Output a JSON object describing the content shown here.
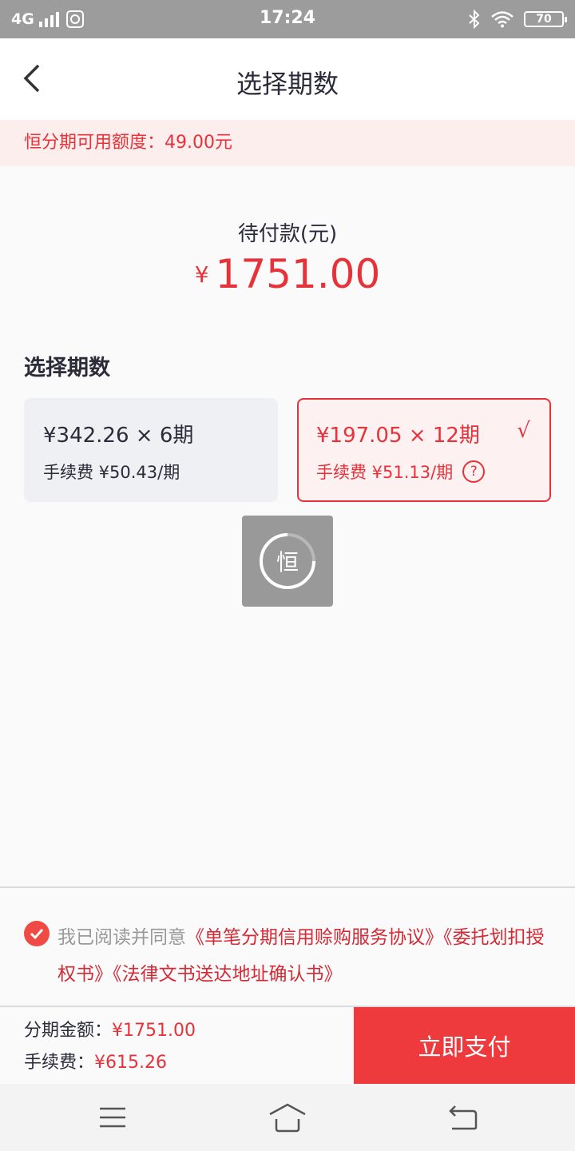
{
  "status_bar": {
    "network": "4G",
    "time": "17:24",
    "battery": "70"
  },
  "header": {
    "title": "选择期数"
  },
  "limit_banner": {
    "text": "恒分期可用额度：49.00元"
  },
  "due": {
    "label": "待付款(元)",
    "currency": "¥",
    "amount": "1751.00"
  },
  "section": {
    "title": "选择期数"
  },
  "plans": [
    {
      "main": "¥342.26 × 6期",
      "fee": "手续费 ¥50.43/期",
      "selected": false
    },
    {
      "main": "¥197.05 × 12期",
      "fee": "手续费 ¥51.13/期",
      "selected": true,
      "check": "√",
      "help": "?"
    }
  ],
  "loader": {
    "char": "恒"
  },
  "agreement": {
    "prefix": "我已阅读并同意",
    "link1": "《单笔分期信用赊购服务协议》",
    "link2": "《委托划扣授权书》",
    "link3": "《法律文书送达地址确认书》",
    "checked": true
  },
  "summary": {
    "amount_label": "分期金额：",
    "amount_value": "¥1751.00",
    "fee_label": "手续费：",
    "fee_value": "¥615.26"
  },
  "pay_button": {
    "label": "立即支付"
  },
  "colors": {
    "accent": "#e8323a",
    "banner_bg": "#fdeeee",
    "pay_button": "#ee3a3c"
  },
  "icons": {
    "back": "chevron-left-icon",
    "menu": "menu-icon",
    "home": "home-icon",
    "return": "return-icon"
  }
}
